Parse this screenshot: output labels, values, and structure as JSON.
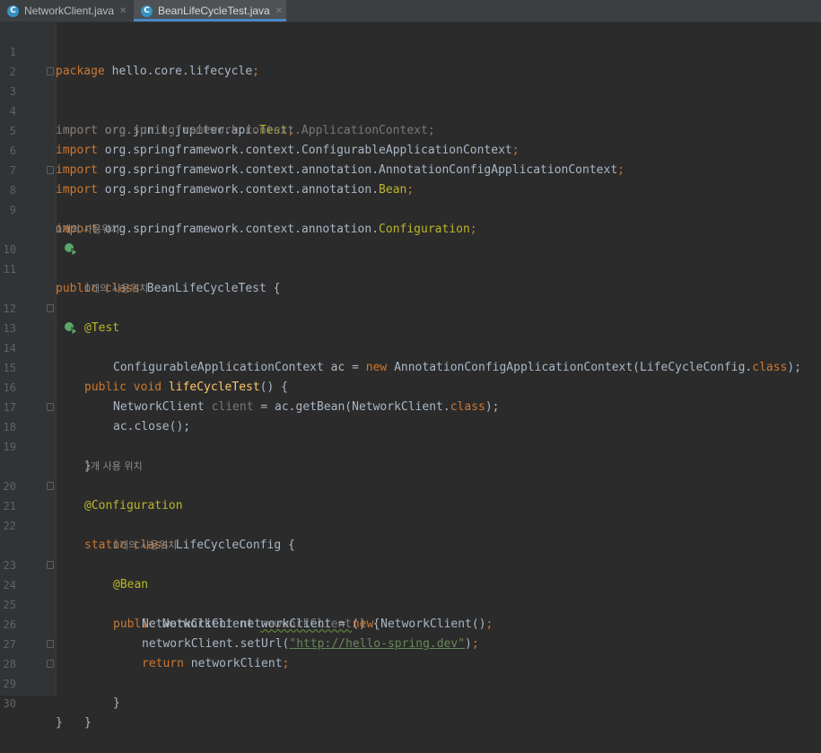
{
  "tabs": [
    {
      "label": "NetworkClient.java",
      "icon": "class-c-icon",
      "active": false
    },
    {
      "label": "BeanLifeCycleTest.java",
      "icon": "class-c-icon",
      "active": true
    }
  ],
  "inlay_hints": {
    "h1": "0개의 사용위치",
    "h2": "0개의 사용위치",
    "h3": "1개 사용 위치",
    "h4": "0개의 사용위치"
  },
  "line_numbers": [
    "1",
    "2",
    "3",
    "4",
    "5",
    "6",
    "7",
    "8",
    "9",
    "10",
    "11",
    "12",
    "13",
    "14",
    "15",
    "16",
    "17",
    "18",
    "19",
    "20",
    "21",
    "22",
    "23",
    "24",
    "25",
    "26",
    "27",
    "28",
    "29",
    "30"
  ],
  "code": {
    "l1": {
      "kw": "package",
      "rest": " hello.core.lifecycle",
      "semi": ";"
    },
    "l3": {
      "kw": "import",
      "pkg": " org.junit.jupiter.api.",
      "cls": "Test",
      "semi": ";"
    },
    "l4": {
      "text": "import org.springframework.context.ApplicationContext;"
    },
    "l5": {
      "kw": "import",
      "rest": " org.springframework.context.ConfigurableApplicationContext",
      "semi": ";"
    },
    "l6": {
      "kw": "import",
      "rest": " org.springframework.context.annotation.AnnotationConfigApplicationContext",
      "semi": ";"
    },
    "l7": {
      "kw": "import",
      "pkg": " org.springframework.context.annotation.",
      "cls": "Bean",
      "semi": ";"
    },
    "l8": {
      "kw": "import",
      "pkg": " org.springframework.context.annotation.",
      "cls": "Configuration",
      "semi": ";"
    },
    "l10": {
      "kw": "public class",
      "rest": " BeanLifeCycleTest {"
    },
    "l12": {
      "ann": "@Test"
    },
    "l13": {
      "kw": "public void",
      "fn": "lifeCycleTest",
      "rest": "() {"
    },
    "l14": {
      "a": "ConfigurableApplicationContext ac = ",
      "kw": "new",
      "b": " AnnotationConfigApplicationContext(LifeCycleConfig.",
      "kw2": "class",
      "c": ");"
    },
    "l16": {
      "a": "NetworkClient ",
      "var": "client",
      "b": " = ac.getBean(NetworkClient.",
      "kw": "class",
      "c": ");"
    },
    "l17": {
      "text": "ac.close();"
    },
    "l18": {
      "text": "}"
    },
    "l20": {
      "ann": "@Configuration"
    },
    "l21": {
      "kw": "static class",
      "rest": " LifeCycleConfig {"
    },
    "l23": {
      "ann": "@Bean"
    },
    "l24": {
      "kw": "public",
      "a": " NetworkClient ",
      "unused": "newworkClient",
      "b": "() {"
    },
    "l25": {
      "a": "NetworkClient networkClient = ",
      "kw": "new",
      "b": " NetworkClient()",
      "semi": ";"
    },
    "l26": {
      "a": "networkClient.setUrl(",
      "str": "\"http://hello-spring.dev\"",
      "b": ")",
      "semi": ";"
    },
    "l27": {
      "kw": "return",
      "a": " networkClient",
      "semi": ";"
    },
    "l28": {
      "text": "}"
    },
    "l29": {
      "text": "}"
    },
    "l30": {
      "text": "}"
    }
  },
  "colors": {
    "background": "#2b2b2b",
    "keyword": "#cc7832",
    "annotation": "#bbb529",
    "method": "#ffc66d",
    "string": "#6a8759",
    "run_icon": "#59a869"
  }
}
